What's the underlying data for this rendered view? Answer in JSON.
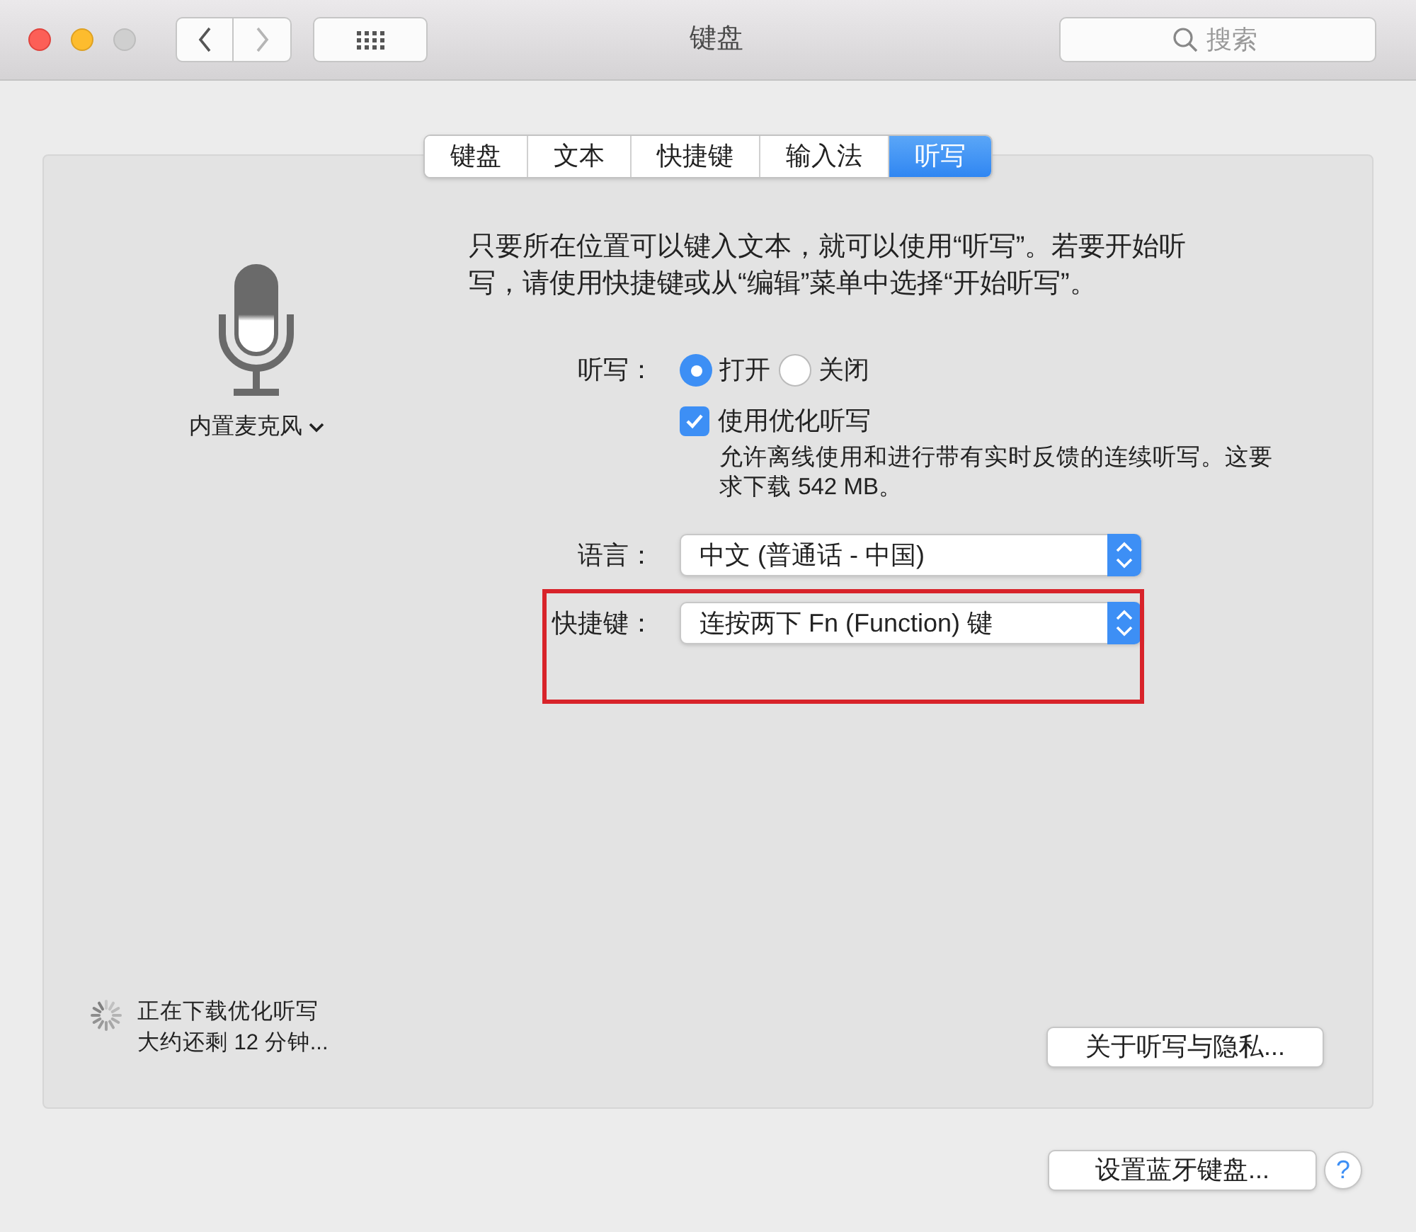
{
  "window": {
    "title": "键盘",
    "search": {
      "placeholder": "搜索"
    }
  },
  "tabs": [
    {
      "label": "键盘",
      "selected": false
    },
    {
      "label": "文本",
      "selected": false
    },
    {
      "label": "快捷键",
      "selected": false
    },
    {
      "label": "输入法",
      "selected": false
    },
    {
      "label": "听写",
      "selected": true
    }
  ],
  "microphone": {
    "label": "内置麦克风"
  },
  "description": "只要所在位置可以键入文本，就可以使用“听写”。若要开始听写，请使用快捷键或从“编辑”菜单中选择“开始听写”。",
  "dictation": {
    "label": "听写：",
    "options": [
      {
        "label": "打开",
        "selected": true
      },
      {
        "label": "关闭",
        "selected": false
      }
    ]
  },
  "enhanced": {
    "label": "使用优化听写",
    "checked": true,
    "note": "允许离线使用和进行带有实时反馈的连续听写。这要求下载 542 MB。"
  },
  "language": {
    "label": "语言：",
    "value": "中文 (普通话 - 中国)"
  },
  "shortcut": {
    "label": "快捷键：",
    "value": "连按两下 Fn (Function) 键"
  },
  "download_status": [
    "正在下载优化听写",
    "大约还剩 12 分钟..."
  ],
  "privacy_button": "关于听写与隐私...",
  "bluetooth_button": "设置蓝牙键盘...",
  "help": "?"
}
